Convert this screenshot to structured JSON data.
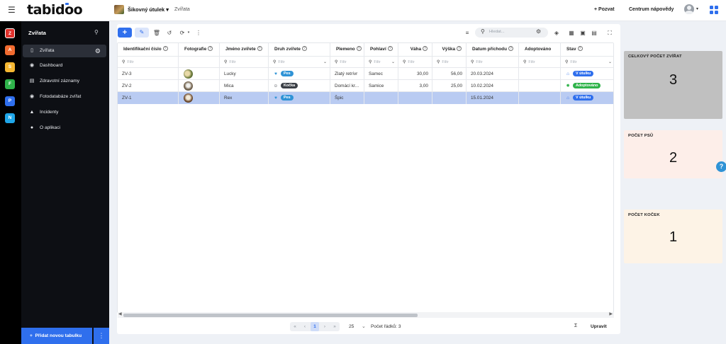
{
  "app": {
    "logo_main": "tabid",
    "logo_oo": "oo",
    "workspace": "Šikovný útulek",
    "breadcrumb": "Zvířata",
    "invite": "Pozvat",
    "help_center": "Centrum nápovědy"
  },
  "rail": [
    {
      "letter": "Z",
      "color": "#e0312b"
    },
    {
      "letter": "A",
      "color": "#f26b2f"
    },
    {
      "letter": "S",
      "color": "#f5b731"
    },
    {
      "letter": "F",
      "color": "#2fb34a"
    },
    {
      "letter": "P",
      "color": "#2f6fed"
    },
    {
      "letter": "N",
      "color": "#1fa6e8"
    }
  ],
  "sidebar": {
    "title": "Zvířata",
    "items": [
      {
        "label": "Zvířata",
        "icon": "trash-can-icon"
      },
      {
        "label": "Dashboard",
        "icon": "camera-icon"
      },
      {
        "label": "Zdravotní záznamy",
        "icon": "book-icon"
      },
      {
        "label": "Fotodatabáze zvířat",
        "icon": "github-icon"
      },
      {
        "label": "Incidenty",
        "icon": "megaphone-icon"
      },
      {
        "label": "O aplikaci",
        "icon": "bulb-icon"
      }
    ],
    "add_table": "Přidat novou tabulku"
  },
  "toolbar": {
    "search_placeholder": "Hledat..."
  },
  "table": {
    "columns": [
      "Identifikační číslo",
      "Fotografie",
      "Jméno zvířete",
      "Druh zvířete",
      "Plemeno",
      "Pohlaví",
      "Váha",
      "Výška",
      "Datum příchodu",
      "Adoptováno",
      "Stav"
    ],
    "filter_placeholder": "Filtr",
    "rows": [
      {
        "id": "ZV-3",
        "name": "Lucky",
        "species": "Pes",
        "breed": "Zlatý retrívr",
        "sex": "Samec",
        "weight": "30,00",
        "height": "56,00",
        "arrival": "20.03.2024",
        "adopted": "",
        "status": "V útulku"
      },
      {
        "id": "ZV-2",
        "name": "Mica",
        "species": "Kočka",
        "breed": "Domácí kr...",
        "sex": "Samice",
        "weight": "3,00",
        "height": "25,00",
        "arrival": "10.02.2024",
        "adopted": "",
        "status": "Adoptováno"
      },
      {
        "id": "ZV-1",
        "name": "Rex",
        "species": "Pes",
        "breed": "Špic",
        "sex": "",
        "weight": "",
        "height": "",
        "arrival": "15.01.2024",
        "adopted": "",
        "status": "V útulku"
      }
    ],
    "colors": {
      "pes": "#2f93d6",
      "kocka": "#3b3f46",
      "v_utulku": "#2f6fed",
      "adoptovano": "#2fb34a",
      "selected_row": "#b9cbf2"
    }
  },
  "footer": {
    "current_page": "1",
    "page_size": "25",
    "row_count": "Počet řádků: 3",
    "sigma": "Σ",
    "edit": "Upravit"
  },
  "stats": [
    {
      "title": "CELKOVÝ POČET ZVÍŘAT",
      "value": "3",
      "bg": "#c0c0c0"
    },
    {
      "title": "POČET PSŮ",
      "value": "2",
      "bg": "#fdeee9"
    },
    {
      "title": "POČET KOČEK",
      "value": "1",
      "bg": "#fdf3e6"
    }
  ]
}
